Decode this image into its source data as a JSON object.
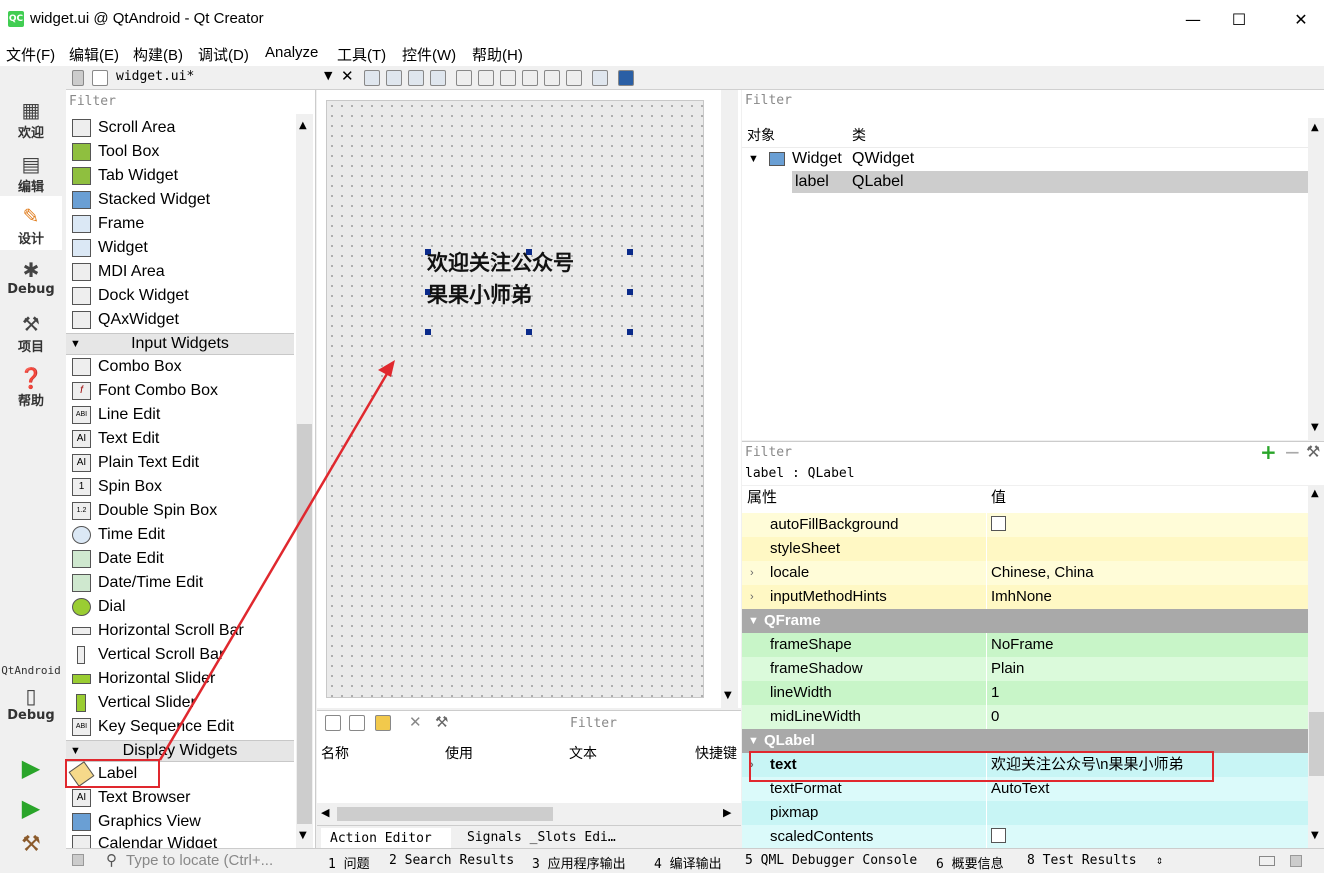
{
  "window": {
    "title": "widget.ui @ QtAndroid - Qt Creator",
    "logo": "QC",
    "minimize": "—",
    "maximize": "☐",
    "close": "✕"
  },
  "menu": [
    "文件(F)",
    "编辑(E)",
    "构建(B)",
    "调试(D)",
    "Analyze",
    "工具(T)",
    "控件(W)",
    "帮助(H)"
  ],
  "modes": [
    {
      "label": "欢迎",
      "icon": "grid-icon"
    },
    {
      "label": "编辑",
      "icon": "document-icon"
    },
    {
      "label": "设计",
      "icon": "pencil-icon"
    },
    {
      "label": "Debug",
      "icon": "bug-icon"
    },
    {
      "label": "项目",
      "icon": "wrench-icon"
    },
    {
      "label": "帮助",
      "icon": "help-icon"
    }
  ],
  "kit": {
    "project": "QtAndroid",
    "mode": "Debug"
  },
  "editor_toolbar": {
    "file": "widget.ui*"
  },
  "widget_box": {
    "filter": "Filter",
    "containers": [
      "Scroll Area",
      "Tool Box",
      "Tab Widget",
      "Stacked Widget",
      "Frame",
      "Widget",
      "MDI Area",
      "Dock Widget",
      "QAxWidget"
    ],
    "input_category": "Input Widgets",
    "inputs": [
      "Combo Box",
      "Font Combo Box",
      "Line Edit",
      "Text Edit",
      "Plain Text Edit",
      "Spin Box",
      "Double Spin Box",
      "Time Edit",
      "Date Edit",
      "Date/Time Edit",
      "Dial",
      "Horizontal Scroll Bar",
      "Vertical Scroll Bar",
      "Horizontal Slider",
      "Vertical Slider",
      "Key Sequence Edit"
    ],
    "display_category": "Display Widgets",
    "displays": [
      "Label",
      "Text Browser",
      "Graphics View",
      "Calendar Widget"
    ]
  },
  "form": {
    "label_line1": "欢迎关注公众号",
    "label_line2": "果果小师弟"
  },
  "action_editor": {
    "filter": "Filter",
    "columns": [
      "名称",
      "使用",
      "文本",
      "快捷键"
    ],
    "tabs": [
      "Action Editor",
      "Signals _Slots Edi…"
    ]
  },
  "object_inspector": {
    "filter": "Filter",
    "columns": [
      "对象",
      "类"
    ],
    "rows": [
      {
        "object": "Widget",
        "class": "QWidget"
      },
      {
        "object": "label",
        "class": "QLabel"
      }
    ]
  },
  "property_editor": {
    "filter": "Filter",
    "class_line": "label : QLabel",
    "columns": [
      "属性",
      "值"
    ],
    "rows_top": [
      {
        "name": "autoFillBackground",
        "value": "",
        "checkbox": true
      },
      {
        "name": "styleSheet",
        "value": ""
      },
      {
        "name": "locale",
        "value": "Chinese, China",
        "expandable": true
      },
      {
        "name": "inputMethodHints",
        "value": "ImhNone",
        "expandable": true
      }
    ],
    "section_qframe": "QFrame",
    "rows_frame": [
      {
        "name": "frameShape",
        "value": "NoFrame"
      },
      {
        "name": "frameShadow",
        "value": "Plain"
      },
      {
        "name": "lineWidth",
        "value": "1"
      },
      {
        "name": "midLineWidth",
        "value": "0"
      }
    ],
    "section_qlabel": "QLabel",
    "rows_label": [
      {
        "name": "text",
        "value": "欢迎关注公众号\\n果果小师弟",
        "expandable": true
      },
      {
        "name": "textFormat",
        "value": "AutoText"
      },
      {
        "name": "pixmap",
        "value": ""
      },
      {
        "name": "scaledContents",
        "value": "",
        "checkbox": true
      }
    ]
  },
  "statusbar": {
    "locate_placeholder": "Type to locate (Ctrl+...",
    "panes": [
      "1 问题",
      "2 Search Results",
      "3 应用程序输出",
      "4 编译输出",
      "5 QML Debugger Console",
      "6 概要信息",
      "8 Test Results"
    ]
  },
  "colors": {
    "annotation": "#e0282e",
    "qobject_rows": "#fffcd8",
    "qframe_rows": "#c8f5c8",
    "qlabel_rows": "#c8f5f5",
    "selection": "#cdcdcd"
  }
}
